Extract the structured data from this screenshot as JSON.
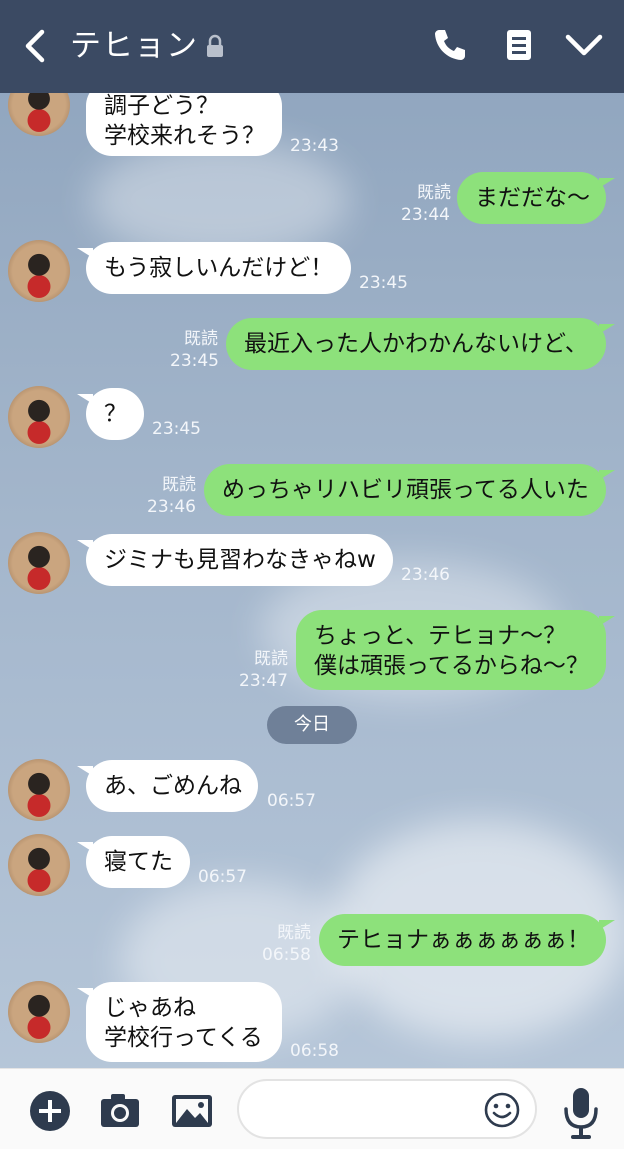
{
  "header": {
    "title": "テヒョン",
    "icons": [
      "back-icon",
      "lock-icon",
      "phone-icon",
      "notes-icon",
      "chevron-down-icon"
    ]
  },
  "messages": [
    {
      "side": "in",
      "text": "調子どう？\n学校来れそう？",
      "time": "23:43"
    },
    {
      "side": "out",
      "text": "まだだな〜",
      "time": "23:44",
      "read": "既読"
    },
    {
      "side": "in",
      "text": "もう寂しいんだけど！",
      "time": "23:45"
    },
    {
      "side": "out",
      "text": "最近入った人かわかんないけど、",
      "time": "23:45",
      "read": "既読"
    },
    {
      "side": "in",
      "text": "？",
      "time": "23:45"
    },
    {
      "side": "out",
      "text": "めっちゃリハビリ頑張ってる人いた",
      "time": "23:46",
      "read": "既読"
    },
    {
      "side": "in",
      "text": "ジミナも見習わなきゃねw",
      "time": "23:46"
    },
    {
      "side": "out",
      "text": "ちょっと、テヒョナ〜？\n僕は頑張ってるからね〜？",
      "time": "23:47",
      "read": "既読"
    },
    {
      "side": "in",
      "text": "あ、ごめんね",
      "time": "06:57"
    },
    {
      "side": "in",
      "text": "寝てた",
      "time": "06:57"
    },
    {
      "side": "out",
      "text": "テヒョナぁぁぁぁぁぁ！",
      "time": "06:58",
      "read": "既読"
    },
    {
      "side": "in",
      "text": "じゃあね\n学校行ってくる",
      "time": "06:58"
    }
  ],
  "date_separator": "今日",
  "input_bar": {
    "icons": [
      "plus-icon",
      "camera-icon",
      "image-icon",
      "smiley-icon",
      "microphone-icon"
    ],
    "text_value": ""
  },
  "colors": {
    "header_bg": "#3b4a63",
    "outgoing_bubble": "#8de17b",
    "incoming_bubble": "#ffffff"
  }
}
